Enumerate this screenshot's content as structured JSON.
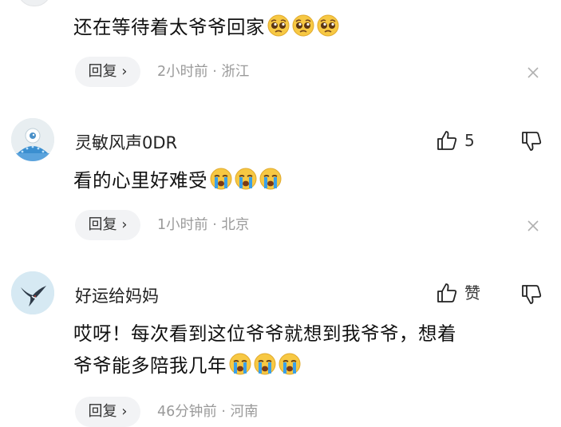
{
  "comments": [
    {
      "username": "",
      "content": "还在等待着太爷爷回家",
      "emoji_count": 3,
      "emoji": "pleading-face",
      "reply_label": "回复 ›",
      "meta": "2小时前 · 浙江"
    },
    {
      "username": "灵敏风声0DR",
      "content": "看的心里好难受",
      "emoji_count": 3,
      "emoji": "crying-face",
      "like_count": "5",
      "reply_label": "回复 ›",
      "meta": "1小时前 · 北京"
    },
    {
      "username": "好运给妈妈",
      "content_line1": "哎呀！每次看到这位爷爷就想到我爷爷，想着",
      "content_line2": "爷爷能多陪我几年",
      "emoji_count": 3,
      "emoji": "crying-face",
      "like_count": "赞",
      "reply_label": "回复 ›",
      "meta": "46分钟前 · 河南"
    }
  ],
  "colors": {
    "background": "#ffffff",
    "reply_bg": "#f2f3f5",
    "meta_text": "#9a9a9a",
    "emoji_yellow": "#f7c843",
    "tears_blue": "#3aa0e8"
  }
}
